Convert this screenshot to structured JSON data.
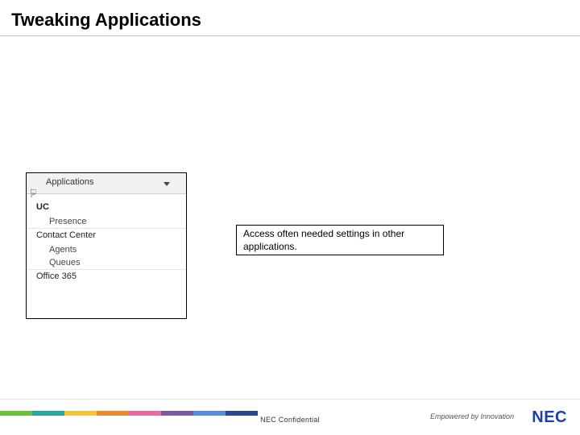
{
  "title": "Tweaking Applications",
  "dropdown": {
    "header_label": "Applications",
    "uc_label": "UC",
    "presence_label": "Presence",
    "contact_center_label": "Contact Center",
    "agents_label": "Agents",
    "queues_label": "Queues",
    "office365_label": "Office 365"
  },
  "callout_text": "Access often needed settings in other applications.",
  "footer": {
    "confidential": "NEC Confidential",
    "tagline": "Empowered by Innovation",
    "logo": "NEC"
  }
}
